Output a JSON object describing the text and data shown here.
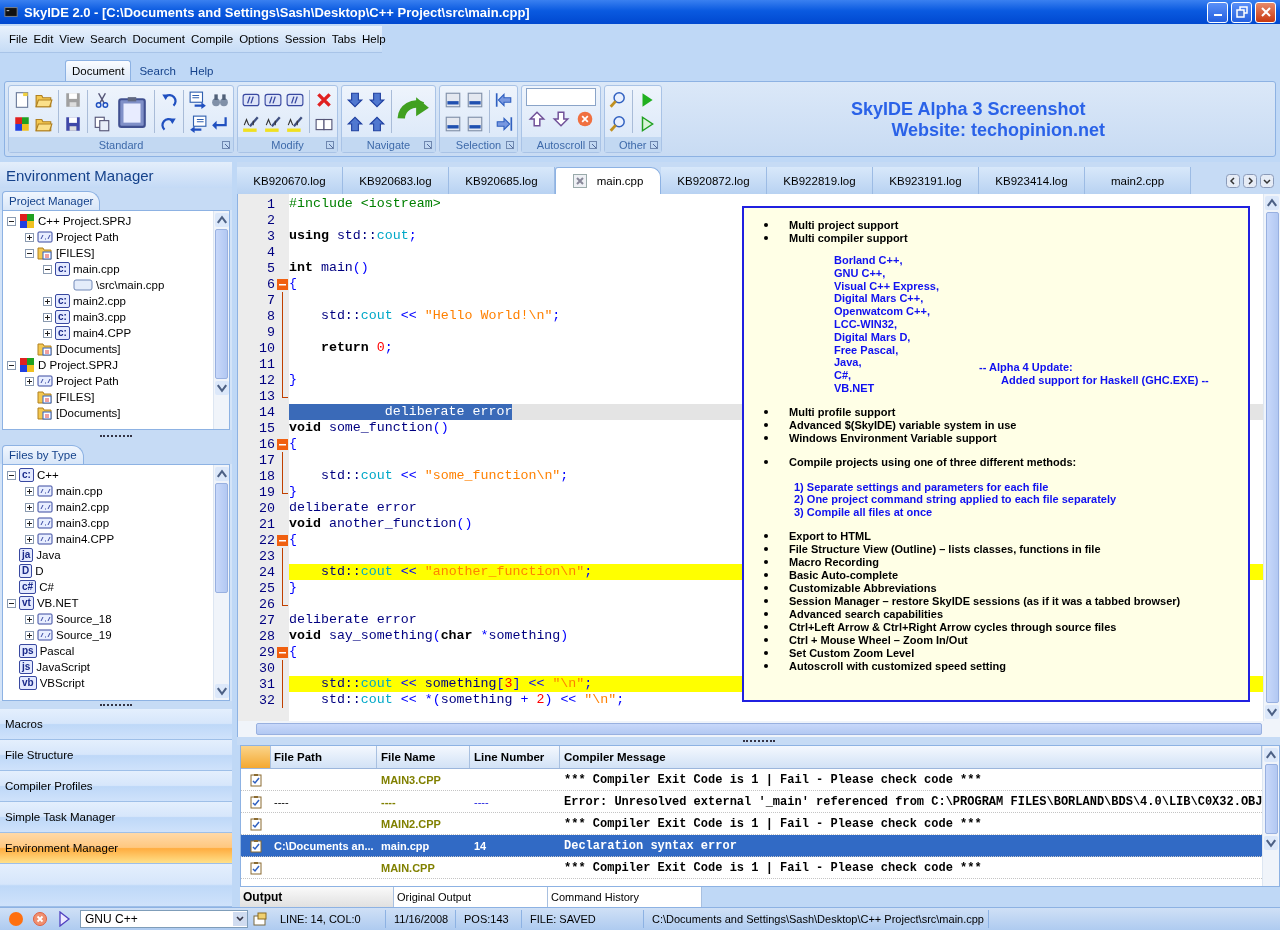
{
  "window": {
    "title": "SkyIDE 2.0 - [C:\\Documents and Settings\\Sash\\Desktop\\C++ Project\\src\\main.cpp]"
  },
  "menu": [
    "File",
    "Edit",
    "View",
    "Search",
    "Document",
    "Compile",
    "Options",
    "Session",
    "Tabs",
    "Help"
  ],
  "ribbon_tabs": [
    {
      "label": "Document",
      "selected": true
    },
    {
      "label": "Search",
      "selected": false
    },
    {
      "label": "Help",
      "selected": false
    }
  ],
  "ribbon_groups": [
    {
      "label": "Standard"
    },
    {
      "label": "Modify"
    },
    {
      "label": "Navigate"
    },
    {
      "label": "Selection"
    },
    {
      "label": "Autoscroll"
    },
    {
      "label": "Other"
    }
  ],
  "banner": [
    "SkyIDE Alpha 3 Screenshot",
    "Website: techopinion.net"
  ],
  "side_title": "Environment Manager",
  "project_tab": "Project Manager",
  "project_tree": [
    {
      "label": "C++ Project.SPRJ",
      "kind": "project",
      "expanded": true,
      "children": [
        {
          "label": "Project Path",
          "kind": "path",
          "expanded": false
        },
        {
          "label": "[FILES]",
          "kind": "folder",
          "expanded": true,
          "children": [
            {
              "label": "main.cpp",
              "kind": "badge",
              "badge": "c:",
              "expanded": true,
              "children": [
                {
                  "label": "\\src\\main.cpp",
                  "kind": "file"
                }
              ]
            },
            {
              "label": "main2.cpp",
              "kind": "badge",
              "badge": "c:",
              "expanded": false
            },
            {
              "label": "main3.cpp",
              "kind": "badge",
              "badge": "c:",
              "expanded": false
            },
            {
              "label": "main4.CPP",
              "kind": "badge",
              "badge": "c:",
              "expanded": false
            }
          ]
        },
        {
          "label": "[Documents]",
          "kind": "folder"
        }
      ]
    },
    {
      "label": "D Project.SPRJ",
      "kind": "project",
      "expanded": true,
      "children": [
        {
          "label": "Project Path",
          "kind": "path",
          "expanded": false
        },
        {
          "label": "[FILES]",
          "kind": "folder"
        },
        {
          "label": "[Documents]",
          "kind": "folder"
        }
      ]
    }
  ],
  "types_tab": "Files by Type",
  "types_tree": [
    {
      "label": "C++",
      "kind": "badge",
      "badge": "c:",
      "expanded": true,
      "children": [
        {
          "label": "main.cpp",
          "kind": "path",
          "expanded": false
        },
        {
          "label": "main2.cpp",
          "kind": "path",
          "expanded": false
        },
        {
          "label": "main3.cpp",
          "kind": "path",
          "expanded": false
        },
        {
          "label": "main4.CPP",
          "kind": "path",
          "expanded": false
        }
      ]
    },
    {
      "label": "Java",
      "kind": "badge",
      "badge": "ja"
    },
    {
      "label": "D",
      "kind": "badge",
      "badge": "D"
    },
    {
      "label": "C#",
      "kind": "badge",
      "badge": "c#"
    },
    {
      "label": "VB.NET",
      "kind": "badge",
      "badge": "vt",
      "expanded": true,
      "children": [
        {
          "label": "Source_18",
          "kind": "path",
          "expanded": false
        },
        {
          "label": "Source_19",
          "kind": "path",
          "expanded": false
        }
      ]
    },
    {
      "label": "Pascal",
      "kind": "badge",
      "badge": "ps"
    },
    {
      "label": "JavaScript",
      "kind": "badge",
      "badge": "js"
    },
    {
      "label": "VBScript",
      "kind": "badge",
      "badge": "vb"
    }
  ],
  "nav": [
    {
      "label": "Macros",
      "selected": false
    },
    {
      "label": "File Structure",
      "selected": false
    },
    {
      "label": "Compiler Profiles",
      "selected": false
    },
    {
      "label": "Simple Task Manager",
      "selected": false
    },
    {
      "label": "Environment Manager",
      "selected": true
    }
  ],
  "editor_tabs": [
    {
      "label": "KB920670.log",
      "selected": false
    },
    {
      "label": "KB920683.log",
      "selected": false
    },
    {
      "label": "KB920685.log",
      "selected": false
    },
    {
      "label": "main.cpp",
      "selected": true
    },
    {
      "label": "KB920872.log",
      "selected": false
    },
    {
      "label": "KB922819.log",
      "selected": false
    },
    {
      "label": "KB923191.log",
      "selected": false
    },
    {
      "label": "KB923414.log",
      "selected": false
    },
    {
      "label": "main2.cpp",
      "selected": false
    }
  ],
  "code": {
    "lines": [
      {
        "n": "1",
        "kind": "plain",
        "current": false,
        "marked": false,
        "t": "#include <iostream>"
      },
      {
        "n": "2",
        "kind": "plain",
        "current": false,
        "marked": false
      },
      {
        "n": "3",
        "kind": "plain",
        "current": false,
        "marked": false,
        "t": "**using** std::cout;"
      },
      {
        "n": "4",
        "kind": "plain",
        "current": false,
        "marked": false
      },
      {
        "n": "5",
        "kind": "plain",
        "current": false,
        "marked": false,
        "t": "**int** main()"
      },
      {
        "n": "6",
        "kind": "fold-start",
        "current": false,
        "marked": false,
        "t": "{"
      },
      {
        "n": "7",
        "kind": "fold-line",
        "current": false,
        "marked": false
      },
      {
        "n": "8",
        "kind": "fold-line",
        "current": false,
        "marked": false,
        "t": "    std::cout << \"Hello World!\\n\";"
      },
      {
        "n": "9",
        "kind": "fold-line",
        "current": false,
        "marked": false
      },
      {
        "n": "10",
        "kind": "fold-line",
        "current": false,
        "marked": false,
        "t": "    **return** 0;"
      },
      {
        "n": "11",
        "kind": "fold-line",
        "current": false,
        "marked": false
      },
      {
        "n": "12",
        "kind": "fold-line",
        "current": false,
        "marked": false,
        "t": "}"
      },
      {
        "n": "13",
        "kind": "fold-end",
        "current": false,
        "marked": false
      },
      {
        "n": "14",
        "kind": "plain",
        "current": true,
        "marked": false,
        "selected": true,
        "t": "            deliberate error"
      },
      {
        "n": "15",
        "kind": "plain",
        "current": false,
        "marked": false,
        "t": "**void** some_function()"
      },
      {
        "n": "16",
        "kind": "fold-start",
        "current": false,
        "marked": false,
        "t": "{"
      },
      {
        "n": "17",
        "kind": "fold-line",
        "current": false,
        "marked": false
      },
      {
        "n": "18",
        "kind": "fold-line",
        "current": false,
        "marked": false,
        "t": "    std::cout << \"some_function\\n\";"
      },
      {
        "n": "19",
        "kind": "fold-end",
        "current": false,
        "marked": false,
        "t": "}"
      },
      {
        "n": "20",
        "kind": "plain",
        "current": false,
        "marked": false,
        "t": "deliberate error"
      },
      {
        "n": "21",
        "kind": "plain",
        "current": false,
        "marked": false,
        "t": "**void** another_function()"
      },
      {
        "n": "22",
        "kind": "fold-start",
        "current": false,
        "marked": false,
        "t": "{"
      },
      {
        "n": "23",
        "kind": "fold-line",
        "current": false,
        "marked": false
      },
      {
        "n": "24",
        "kind": "fold-line",
        "current": false,
        "marked": true,
        "t": "    std::cout << \"another_function\\n\";"
      },
      {
        "n": "25",
        "kind": "fold-line",
        "current": false,
        "marked": false,
        "t": "}"
      },
      {
        "n": "26",
        "kind": "fold-end",
        "current": false,
        "marked": false
      },
      {
        "n": "27",
        "kind": "plain",
        "current": false,
        "marked": false,
        "t": "deliberate error"
      },
      {
        "n": "28",
        "kind": "plain",
        "current": false,
        "marked": false,
        "t": "**void** say_something(**char** *something)"
      },
      {
        "n": "29",
        "kind": "fold-start",
        "current": false,
        "marked": false,
        "t": "{"
      },
      {
        "n": "30",
        "kind": "fold-line",
        "current": false,
        "marked": false
      },
      {
        "n": "31",
        "kind": "fold-line",
        "current": false,
        "marked": true,
        "t": "    std::cout << something[3] << \"\\n\";"
      },
      {
        "n": "32",
        "kind": "fold-line",
        "current": false,
        "marked": false,
        "t": "    std::cout << *(something + 2) << \"\\n\";"
      }
    ]
  },
  "note": {
    "sections": [
      {
        "kind": "bullets",
        "items": [
          "Multi project support",
          "Multi compiler support"
        ]
      },
      {
        "kind": "compilers",
        "items": [
          "Borland C++,",
          "GNU C++,",
          "Visual C++ Express,",
          "Digital Mars C++,",
          "Openwatcom C++,",
          "LCC-WIN32,",
          "Digital Mars D,",
          "Free Pascal,",
          "Java,",
          "C#,",
          "VB.NET"
        ],
        "update": [
          "-- Alpha 4 Update:",
          "Added support for Haskell (GHC.EXE) --"
        ]
      },
      {
        "kind": "bullets",
        "items": [
          "Multi profile support",
          "Advanced $(SkyIDE) variable system in use",
          "Windows Environment Variable support"
        ]
      },
      {
        "kind": "bullets",
        "items": [
          "Compile projects using one of three different methods:"
        ]
      },
      {
        "kind": "methods",
        "items": [
          "1) Separate settings and parameters for each file",
          "2) One project command string applied to each file separately",
          "3) Compile all files at once"
        ]
      },
      {
        "kind": "bullets",
        "items": [
          "Export to HTML",
          "File Structure View (Outline) – lists classes, functions in file",
          "Macro Recording",
          "Basic Auto-complete",
          "Customizable Abbreviations",
          "Session Manager – restore SkyIDE sessions (as if it was a tabbed browser)",
          "Advanced search capabilities",
          "Ctrl+Left Arrow & Ctrl+Right Arrow cycles through source files",
          "Ctrl + Mouse Wheel – Zoom In/Out",
          "Set Custom Zoom Level",
          "Autoscroll with customized speed setting"
        ]
      }
    ]
  },
  "output": {
    "columns": [
      "File Path",
      "File Name",
      "Line Number",
      "Compiler Message"
    ],
    "rows": [
      {
        "file_name": "MAIN3.CPP",
        "message": "*** Compiler Exit Code is 1 | Fail - Please check code ***",
        "selected": false
      },
      {
        "file_path": "----",
        "file_name": "----",
        "line_number": "----",
        "message": "Error: Unresolved external '_main' referenced from C:\\PROGRAM FILES\\BORLAND\\BDS\\4.0\\LIB\\C0X32.OBJ",
        "selected": false
      },
      {
        "file_name": "MAIN2.CPP",
        "message": "*** Compiler Exit Code is 1 | Fail - Please check code ***",
        "selected": false
      },
      {
        "file_path": "C:\\Documents an...",
        "file_name": "main.cpp",
        "line_number": "14",
        "message": "Declaration syntax error",
        "selected": true
      },
      {
        "file_name": "MAIN.CPP",
        "message": "*** Compiler Exit Code is 1 | Fail - Please check code ***",
        "selected": false
      }
    ],
    "tabs": [
      {
        "label": "Output",
        "selected": true
      },
      {
        "label": "Original Output",
        "selected": false
      },
      {
        "label": "Command History",
        "selected": false
      }
    ]
  },
  "status": {
    "compiler": "GNU C++",
    "fields": [
      "LINE: 14, COL:0",
      "11/16/2008",
      "POS:143",
      "FILE: SAVED",
      "C:\\Documents and Settings\\Sash\\Desktop\\C++ Project\\src\\main.cpp"
    ]
  }
}
